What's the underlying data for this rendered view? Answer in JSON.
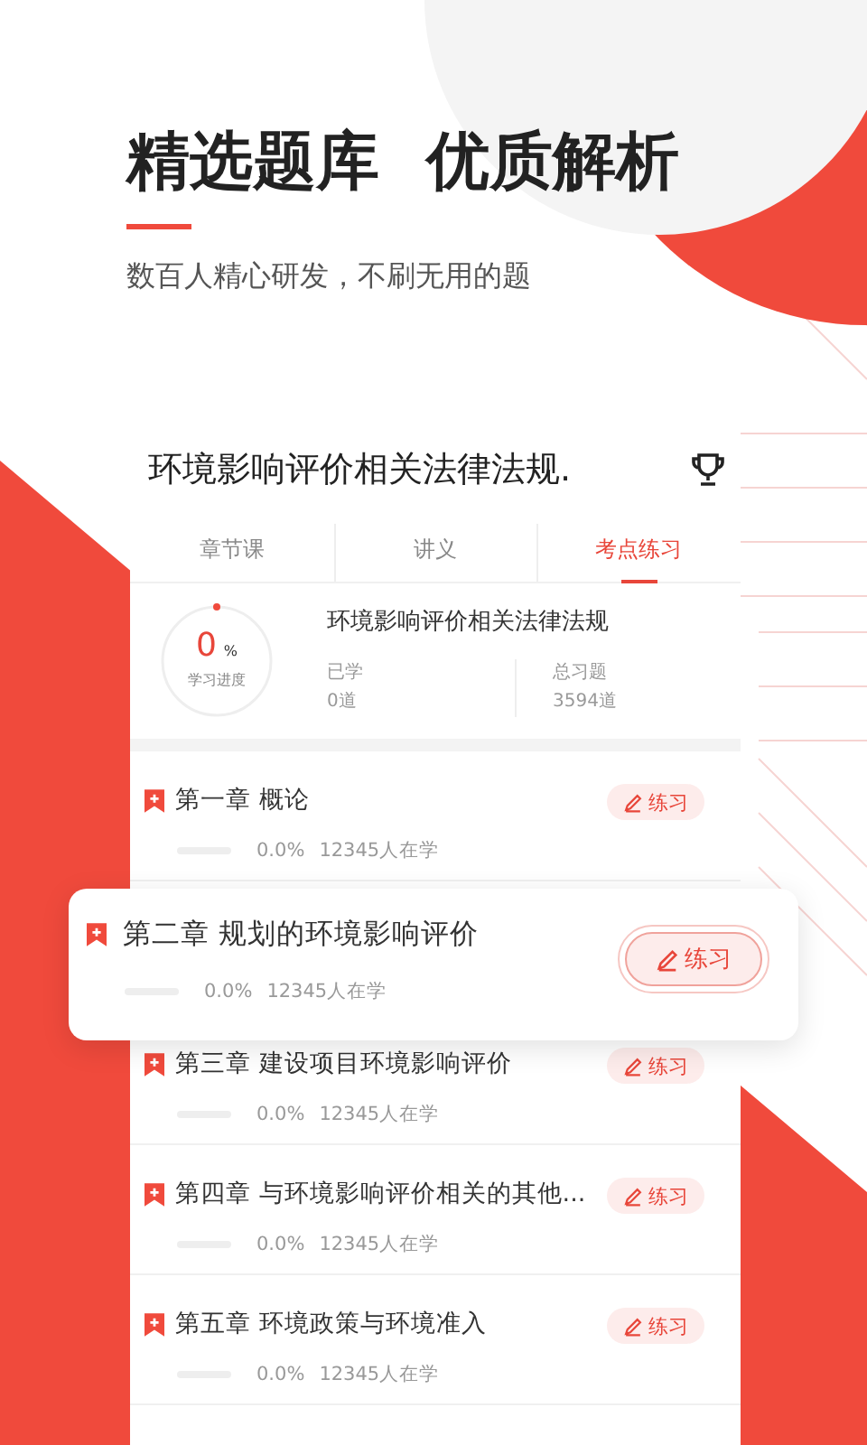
{
  "headline": "精选题库 优质解析",
  "subtitle": "数百人精心研发，不刷无用的题",
  "course": {
    "title": "环境影响评价相关法律法规.",
    "tabs": [
      {
        "label": "章节课",
        "selected": false
      },
      {
        "label": "讲义",
        "selected": false
      },
      {
        "label": "考点练习",
        "selected": true
      }
    ],
    "progress": {
      "value": "0",
      "unit": "%",
      "label": "学习进度"
    },
    "subject": "环境影响评价相关法律法规",
    "stats": [
      {
        "label": "已学",
        "value": "0道"
      },
      {
        "label": "总习题",
        "value": "3594道"
      }
    ],
    "chapters": [
      {
        "title": "第一章 概论",
        "percent": "0.0%",
        "learners": "12345人在学",
        "button": "练习",
        "highlighted": false
      },
      {
        "title": "第二章 规划的环境影响评价",
        "percent": "0.0%",
        "learners": "12345人在学",
        "button": "练习",
        "highlighted": true
      },
      {
        "title": "第三章 建设项目环境影响评价",
        "percent": "0.0%",
        "learners": "12345人在学",
        "button": "练习",
        "highlighted": false
      },
      {
        "title": "第四章 与环境影响评价相关的其他...",
        "percent": "0.0%",
        "learners": "12345人在学",
        "button": "练习",
        "highlighted": false
      },
      {
        "title": "第五章 环境政策与环境准入",
        "percent": "0.0%",
        "learners": "12345人在学",
        "button": "练习",
        "highlighted": false
      }
    ]
  }
}
